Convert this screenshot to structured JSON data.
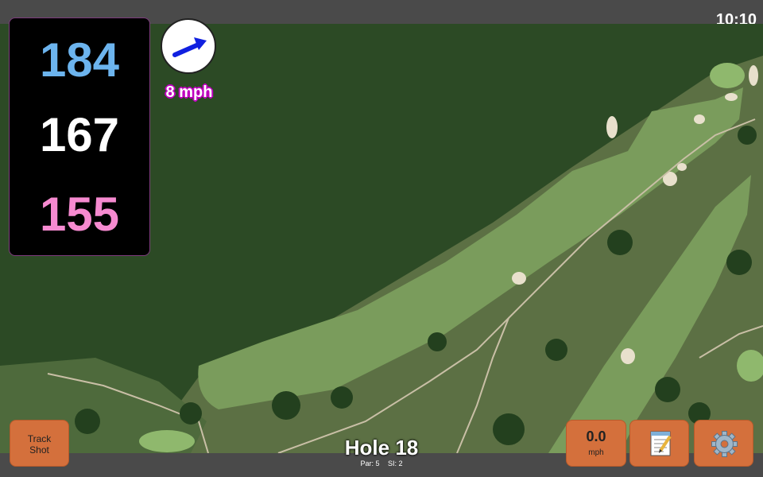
{
  "status": {
    "time": "10:10"
  },
  "distances": {
    "back": "184",
    "middle": "167",
    "front": "155"
  },
  "wind": {
    "speed": "8 mph",
    "icon": "wind-direction-arrow-icon"
  },
  "hole": {
    "title": "Hole 18",
    "par": "Par: 5",
    "si": "SI: 2"
  },
  "buttons": {
    "track_shot_line1": "Track",
    "track_shot_line2": "Shot",
    "speed_value": "0.0",
    "speed_unit": "mph",
    "notes_icon": "notepad-icon",
    "settings_icon": "gear-icon"
  },
  "colors": {
    "back": "#6cb4ee",
    "middle": "#ffffff",
    "front": "#f68ad0",
    "button": "#d4703c",
    "wind_arrow": "#1020e0"
  }
}
